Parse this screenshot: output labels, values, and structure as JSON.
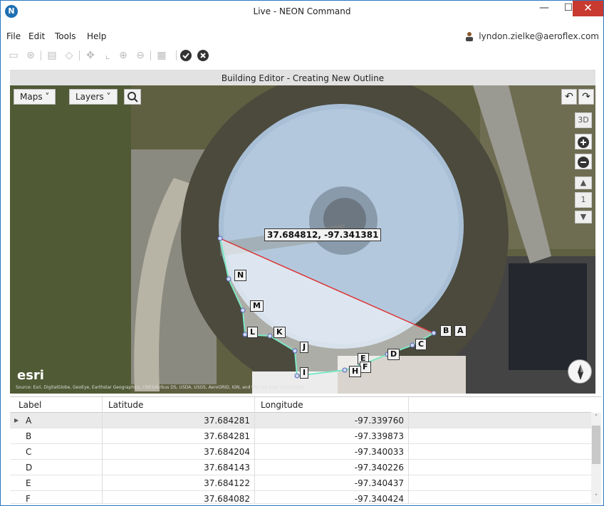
{
  "window": {
    "title": "Live - NEON Command",
    "logo_letter": "N",
    "min": "—",
    "max": "☐",
    "close": "✕"
  },
  "menu": {
    "file": "File",
    "edit": "Edit",
    "tools": "Tools",
    "help": "Help",
    "user": "lyndon.zielke@aeroflex.com"
  },
  "toolbar": {
    "confirm_icon": "check-circle-icon",
    "cancel_icon": "x-circle-icon"
  },
  "editor": {
    "header": "Building Editor - Creating New Outline"
  },
  "map": {
    "maps_button": "Maps ˅",
    "layers_button": "Layers ˅",
    "coord_readout": "37.684812, -97.341381",
    "three_d": "3D",
    "floor": "1",
    "esri": "esri",
    "attribution": "Source: Esri, DigitalGlobe, GeoEye, Earthstar Geographics, CNES/Airbus DS, USDA, USGS, AeroGRID, IGN, and the GIS User Community",
    "points": {
      "A": "A",
      "B": "B",
      "C": "C",
      "D": "D",
      "E": "E",
      "F": "F",
      "H": "H",
      "I": "I",
      "J": "J",
      "K": "K",
      "L": "L",
      "M": "M",
      "N": "N"
    }
  },
  "grid": {
    "columns": [
      "Label",
      "Latitude",
      "Longitude"
    ],
    "rows": [
      {
        "label": "A",
        "lat": "37.684281",
        "lon": "-97.339760"
      },
      {
        "label": "B",
        "lat": "37.684281",
        "lon": "-97.339873"
      },
      {
        "label": "C",
        "lat": "37.684204",
        "lon": "-97.340033"
      },
      {
        "label": "D",
        "lat": "37.684143",
        "lon": "-97.340226"
      },
      {
        "label": "E",
        "lat": "37.684122",
        "lon": "-97.340437"
      },
      {
        "label": "F",
        "lat": "37.684082",
        "lon": "-97.340424"
      }
    ]
  }
}
